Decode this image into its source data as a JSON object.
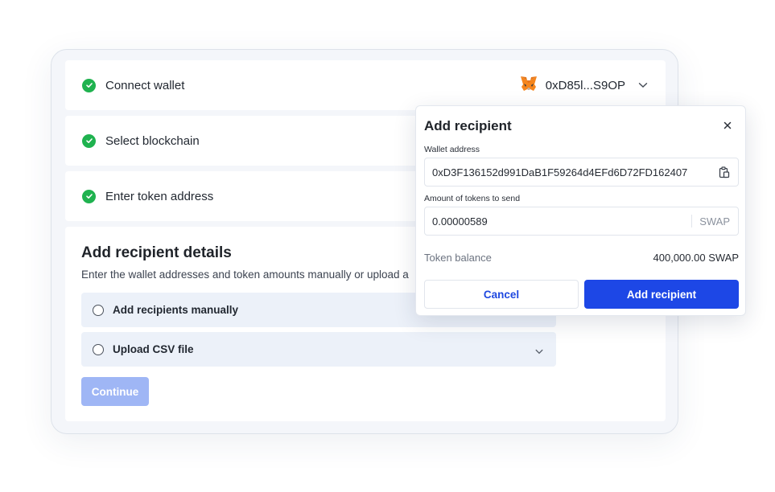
{
  "steps": [
    {
      "label": "Connect wallet",
      "done": true
    },
    {
      "label": "Select blockchain",
      "done": true
    },
    {
      "label": "Enter token address",
      "done": true
    }
  ],
  "wallet": {
    "address": "0xD85l...S9OP",
    "icon": "metamask-fox-icon"
  },
  "details": {
    "title": "Add recipient details",
    "subtitle": "Enter the wallet addresses and token amounts manually or upload a",
    "options": [
      {
        "label": "Add recipients manually",
        "selected": false
      },
      {
        "label": "Upload CSV file",
        "selected": false
      }
    ],
    "continue_label": "Continue"
  },
  "modal": {
    "title": "Add recipient",
    "wallet_label": "Wallet address",
    "wallet_value": "0xD3F136152d991DaB1F59264d4EFd6D72FD162407",
    "amount_label": "Amount of tokens to send",
    "amount_value": "0.00000589",
    "amount_unit": "SWAP",
    "balance_label": "Token balance",
    "balance_value": "400,000.00 SWAP",
    "cancel_label": "Cancel",
    "add_label": "Add recipient"
  },
  "colors": {
    "accent": "#1d47e6",
    "success": "#1fb24f",
    "disabled_button": "#9fb6f5",
    "option_bg": "#ecf1f9"
  }
}
